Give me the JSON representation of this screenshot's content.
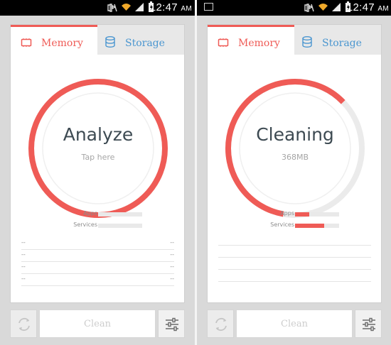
{
  "status_bar": {
    "time": "12:47",
    "ampm": "AM"
  },
  "screens": [
    {
      "tabs": [
        {
          "label": "Memory",
          "active": true
        },
        {
          "label": "Storage",
          "active": false
        }
      ],
      "gauge": {
        "title": "Analyze",
        "subtitle": "Tap here",
        "progress": 1.0
      },
      "meters": [
        {
          "label": "Apps",
          "fraction": 0.0
        },
        {
          "label": "Services",
          "fraction": 0.0
        }
      ],
      "list_rows": [
        {
          "left": "--",
          "right": "--"
        },
        {
          "left": "--",
          "right": "--"
        },
        {
          "left": "--",
          "right": "--"
        },
        {
          "left": "--",
          "right": "--"
        }
      ],
      "buttons": {
        "clean": "Clean"
      }
    },
    {
      "tabs": [
        {
          "label": "Memory",
          "active": true
        },
        {
          "label": "Storage",
          "active": false
        }
      ],
      "gauge": {
        "title": "Cleaning",
        "subtitle": "368MB",
        "progress": 0.6
      },
      "meters": [
        {
          "label": "Apps",
          "fraction": 0.32
        },
        {
          "label": "Services",
          "fraction": 0.66
        }
      ],
      "list_rows": [
        {},
        {},
        {},
        {}
      ],
      "buttons": {
        "clean": "Clean"
      }
    }
  ],
  "colors": {
    "accent": "#ef5b56",
    "storage_blue": "#4a96d0",
    "ring_track": "#ebebeb",
    "text_dark": "#3d4a52"
  },
  "icons": {
    "status": [
      "gallery-icon",
      "mute-icon",
      "wifi-icon",
      "signal-icon",
      "battery-icon"
    ],
    "tabs": [
      "memory-chip-icon",
      "database-icon"
    ],
    "bottom": [
      "refresh-icon",
      "sliders-icon"
    ]
  }
}
